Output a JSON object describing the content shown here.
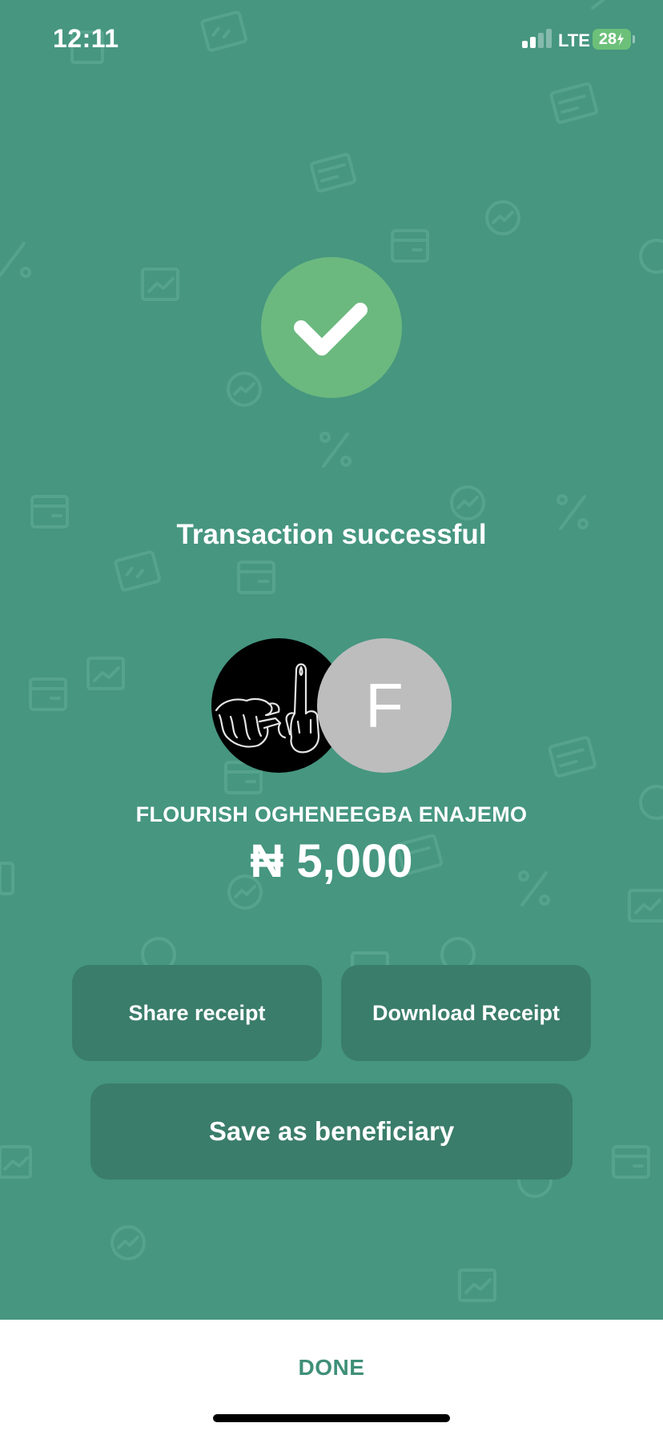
{
  "status_bar": {
    "time": "12:11",
    "network": "LTE",
    "battery": "28"
  },
  "success": {
    "icon": "checkmark-icon",
    "title": "Transaction successful"
  },
  "transfer": {
    "sender_avatar": "hand-gesture-avatar-image",
    "recipient_initial": "F",
    "recipient_name": "FLOURISH OGHENEEGBA ENAJEMO",
    "amount": "₦ 5,000"
  },
  "actions": {
    "share_label": "Share receipt",
    "download_label": "Download Receipt",
    "save_label": "Save as beneficiary"
  },
  "footer": {
    "done_label": "DONE"
  },
  "colors": {
    "background": "#469680",
    "check_circle": "#6bb97f",
    "button": "#3a7d6a",
    "done_text": "#3f8f78"
  }
}
